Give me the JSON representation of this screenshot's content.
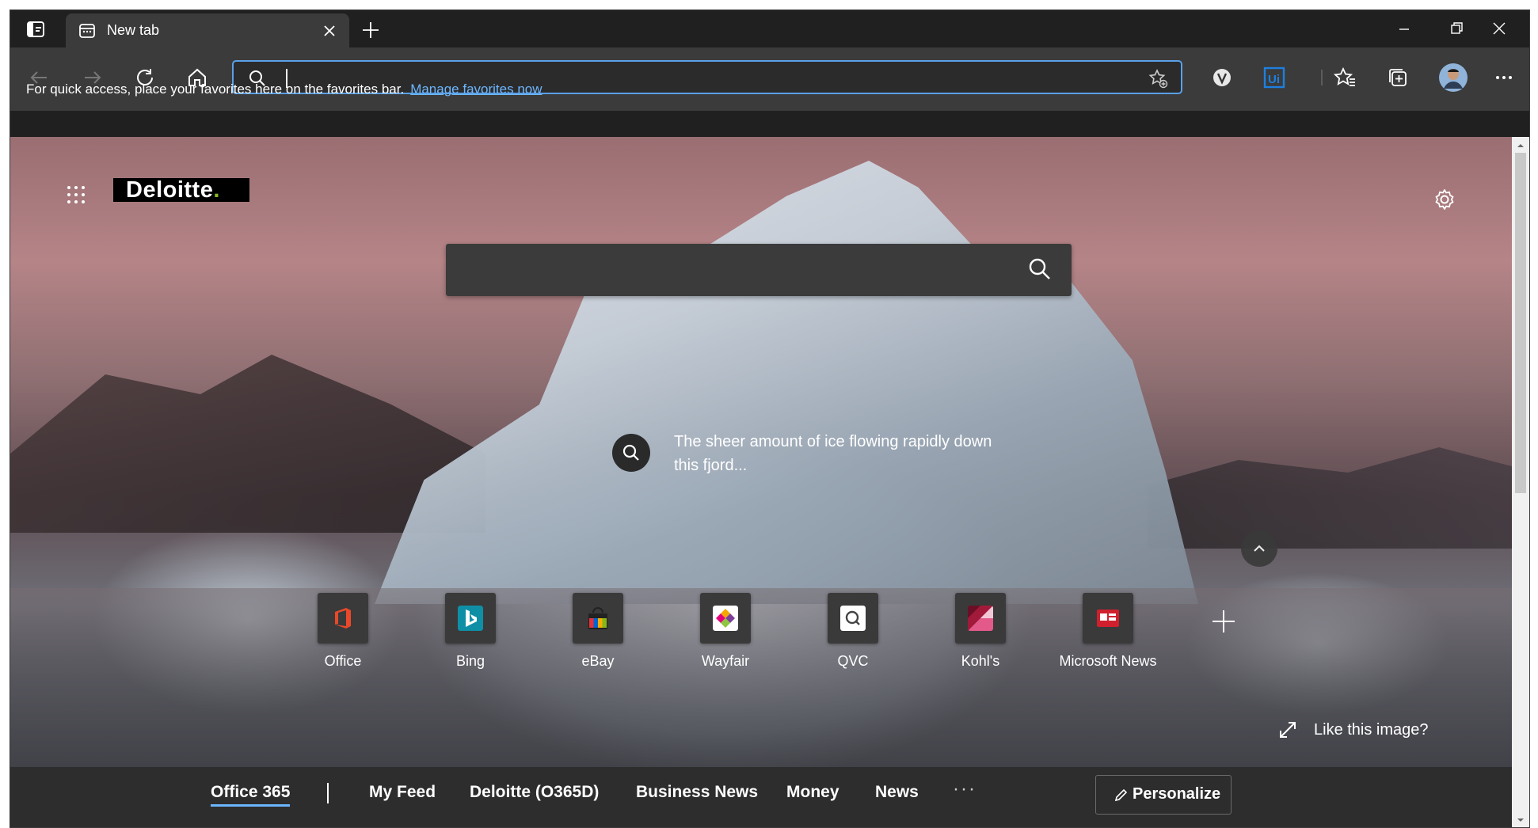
{
  "browser": {
    "tab_title": "New tab",
    "address_value": "",
    "favorites_bar_message": "For quick access, place your favorites here on the favorites bar.",
    "favorites_bar_link": "Manage favorites now"
  },
  "newtab": {
    "brand": "Deloitte",
    "brand_dot": ".",
    "search_placeholder": "",
    "image_caption": "The sheer amount of ice flowing rapidly down this fjord...",
    "quick_links": [
      {
        "label": "Office",
        "color": "#e8492b"
      },
      {
        "label": "Bing",
        "color": "#0f8fa6"
      },
      {
        "label": "eBay",
        "color": "#e53238"
      },
      {
        "label": "Wayfair",
        "color": "#7b3f98"
      },
      {
        "label": "QVC",
        "color": "#444444"
      },
      {
        "label": "Kohl's",
        "color": "#a11a3a"
      },
      {
        "label": "Microsoft News",
        "color": "#d0202e"
      }
    ],
    "like_image": "Like this image?",
    "feed_tabs": [
      "Office 365",
      "My Feed",
      "Deloitte (O365D)",
      "Business News",
      "Money",
      "News"
    ],
    "feed_more": "···",
    "personalize": "Personalize"
  }
}
